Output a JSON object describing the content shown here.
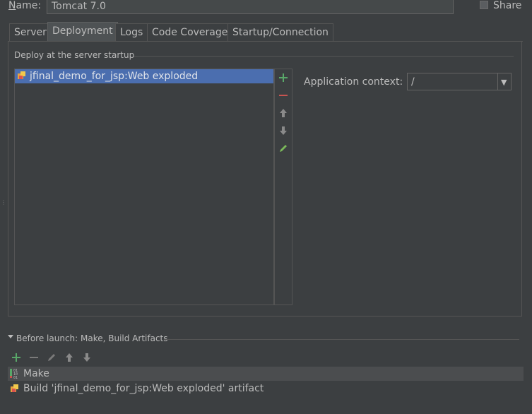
{
  "form": {
    "name_label": "Name:",
    "name_value": "Tomcat 7.0",
    "share_label": "Share",
    "share_checked": false
  },
  "tabs": [
    {
      "label": "Server",
      "active": false
    },
    {
      "label": "Deployment",
      "active": true
    },
    {
      "label": "Logs",
      "active": false
    },
    {
      "label": "Code Coverage",
      "active": false
    },
    {
      "label": "Startup/Connection",
      "active": false
    }
  ],
  "deployment": {
    "section_title": "Deploy at the server startup",
    "artifacts": [
      {
        "label": "jfinal_demo_for_jsp:Web exploded",
        "selected": true,
        "icon": "artifact-icon"
      }
    ],
    "toolbar": [
      "add-icon",
      "remove-icon",
      "move-up-icon",
      "move-down-icon",
      "edit-icon"
    ],
    "context_label": "Application context:",
    "context_value": "/"
  },
  "before_launch": {
    "title": "Before launch: Make, Build Artifacts",
    "toolbar": [
      "add-icon",
      "remove-icon",
      "edit-icon",
      "move-up-icon",
      "move-down-icon"
    ],
    "items": [
      {
        "label": "Make",
        "icon": "make-icon",
        "selected": true
      },
      {
        "label": "Build 'jfinal_demo_for_jsp:Web exploded' artifact",
        "icon": "artifact-icon",
        "selected": false
      }
    ]
  },
  "colors": {
    "background": "#3c3f41",
    "selection": "#4b6eaf",
    "add": "#59a869",
    "remove": "#c75450",
    "edit": "#7ab85a"
  }
}
